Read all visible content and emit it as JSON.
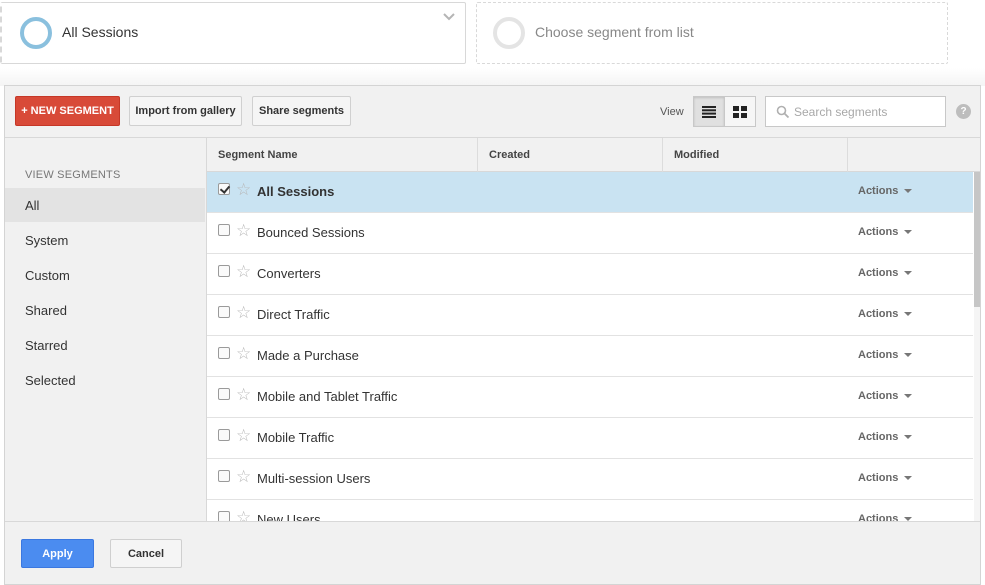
{
  "segments_bar": {
    "active_segment": "All Sessions",
    "empty_slot_label": "Choose segment from list"
  },
  "toolbar": {
    "new_segment_label": "+ NEW SEGMENT",
    "import_label": "Import from gallery",
    "share_label": "Share segments",
    "view_label": "View",
    "view_mode": "list",
    "search_placeholder": "Search segments",
    "help_label": "?"
  },
  "sidebar": {
    "heading": "VIEW SEGMENTS",
    "items": [
      {
        "label": "All",
        "active": true
      },
      {
        "label": "System",
        "active": false
      },
      {
        "label": "Custom",
        "active": false
      },
      {
        "label": "Shared",
        "active": false
      },
      {
        "label": "Starred",
        "active": false
      },
      {
        "label": "Selected",
        "active": false
      }
    ]
  },
  "table": {
    "columns": [
      "Segment Name",
      "Created",
      "Modified",
      ""
    ],
    "rows": [
      {
        "name": "All Sessions",
        "created": "",
        "modified": "",
        "checked": true,
        "actions": "Actions"
      },
      {
        "name": "Bounced Sessions",
        "created": "",
        "modified": "",
        "checked": false,
        "actions": "Actions"
      },
      {
        "name": "Converters",
        "created": "",
        "modified": "",
        "checked": false,
        "actions": "Actions"
      },
      {
        "name": "Direct Traffic",
        "created": "",
        "modified": "",
        "checked": false,
        "actions": "Actions"
      },
      {
        "name": "Made a Purchase",
        "created": "",
        "modified": "",
        "checked": false,
        "actions": "Actions"
      },
      {
        "name": "Mobile and Tablet Traffic",
        "created": "",
        "modified": "",
        "checked": false,
        "actions": "Actions"
      },
      {
        "name": "Mobile Traffic",
        "created": "",
        "modified": "",
        "checked": false,
        "actions": "Actions"
      },
      {
        "name": "Multi-session Users",
        "created": "",
        "modified": "",
        "checked": false,
        "actions": "Actions"
      },
      {
        "name": "New Users",
        "created": "",
        "modified": "",
        "checked": false,
        "actions": "Actions"
      }
    ]
  },
  "footer": {
    "apply_label": "Apply",
    "cancel_label": "Cancel"
  },
  "colors": {
    "new_segment_red": "#d84a38",
    "apply_blue": "#4b8cf0",
    "selected_row": "#c9e3f2",
    "segment_ring": "#8ac0de"
  }
}
